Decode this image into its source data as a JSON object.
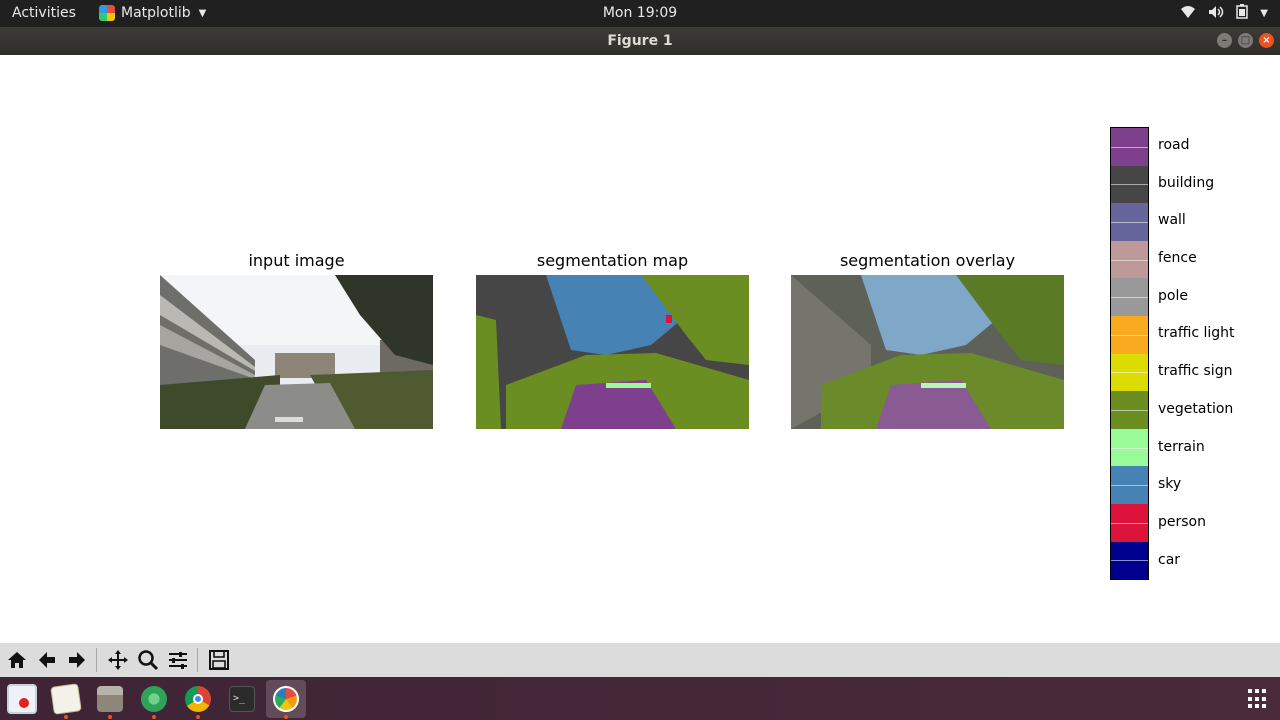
{
  "topbar": {
    "activities": "Activities",
    "app_name": "Matplotlib",
    "clock": "Mon 19:09"
  },
  "window": {
    "title": "Figure 1"
  },
  "figure": {
    "panels": [
      {
        "title": "input image"
      },
      {
        "title": "segmentation map"
      },
      {
        "title": "segmentation overlay"
      }
    ],
    "colorbar": [
      {
        "label": "road",
        "color": "#7e3f8c"
      },
      {
        "label": "building",
        "color": "#464646"
      },
      {
        "label": "wall",
        "color": "#66669c"
      },
      {
        "label": "fence",
        "color": "#be9999"
      },
      {
        "label": "pole",
        "color": "#999999"
      },
      {
        "label": "traffic light",
        "color": "#faaa1e"
      },
      {
        "label": "traffic sign",
        "color": "#dcdc00"
      },
      {
        "label": "vegetation",
        "color": "#6b8e23"
      },
      {
        "label": "terrain",
        "color": "#98fb98"
      },
      {
        "label": "sky",
        "color": "#4682b4"
      },
      {
        "label": "person",
        "color": "#dc143c"
      },
      {
        "label": "car",
        "color": "#00008e"
      }
    ]
  },
  "toolbar": {
    "buttons": [
      "home-icon",
      "back-icon",
      "forward-icon",
      "pan-icon",
      "zoom-icon",
      "configure-subplots-icon",
      "save-icon"
    ]
  },
  "dock": {
    "apps": [
      "screenshot-app-icon",
      "text-editor-icon",
      "files-icon",
      "atom-icon",
      "chrome-icon",
      "terminal-icon",
      "matplotlib-icon"
    ]
  }
}
